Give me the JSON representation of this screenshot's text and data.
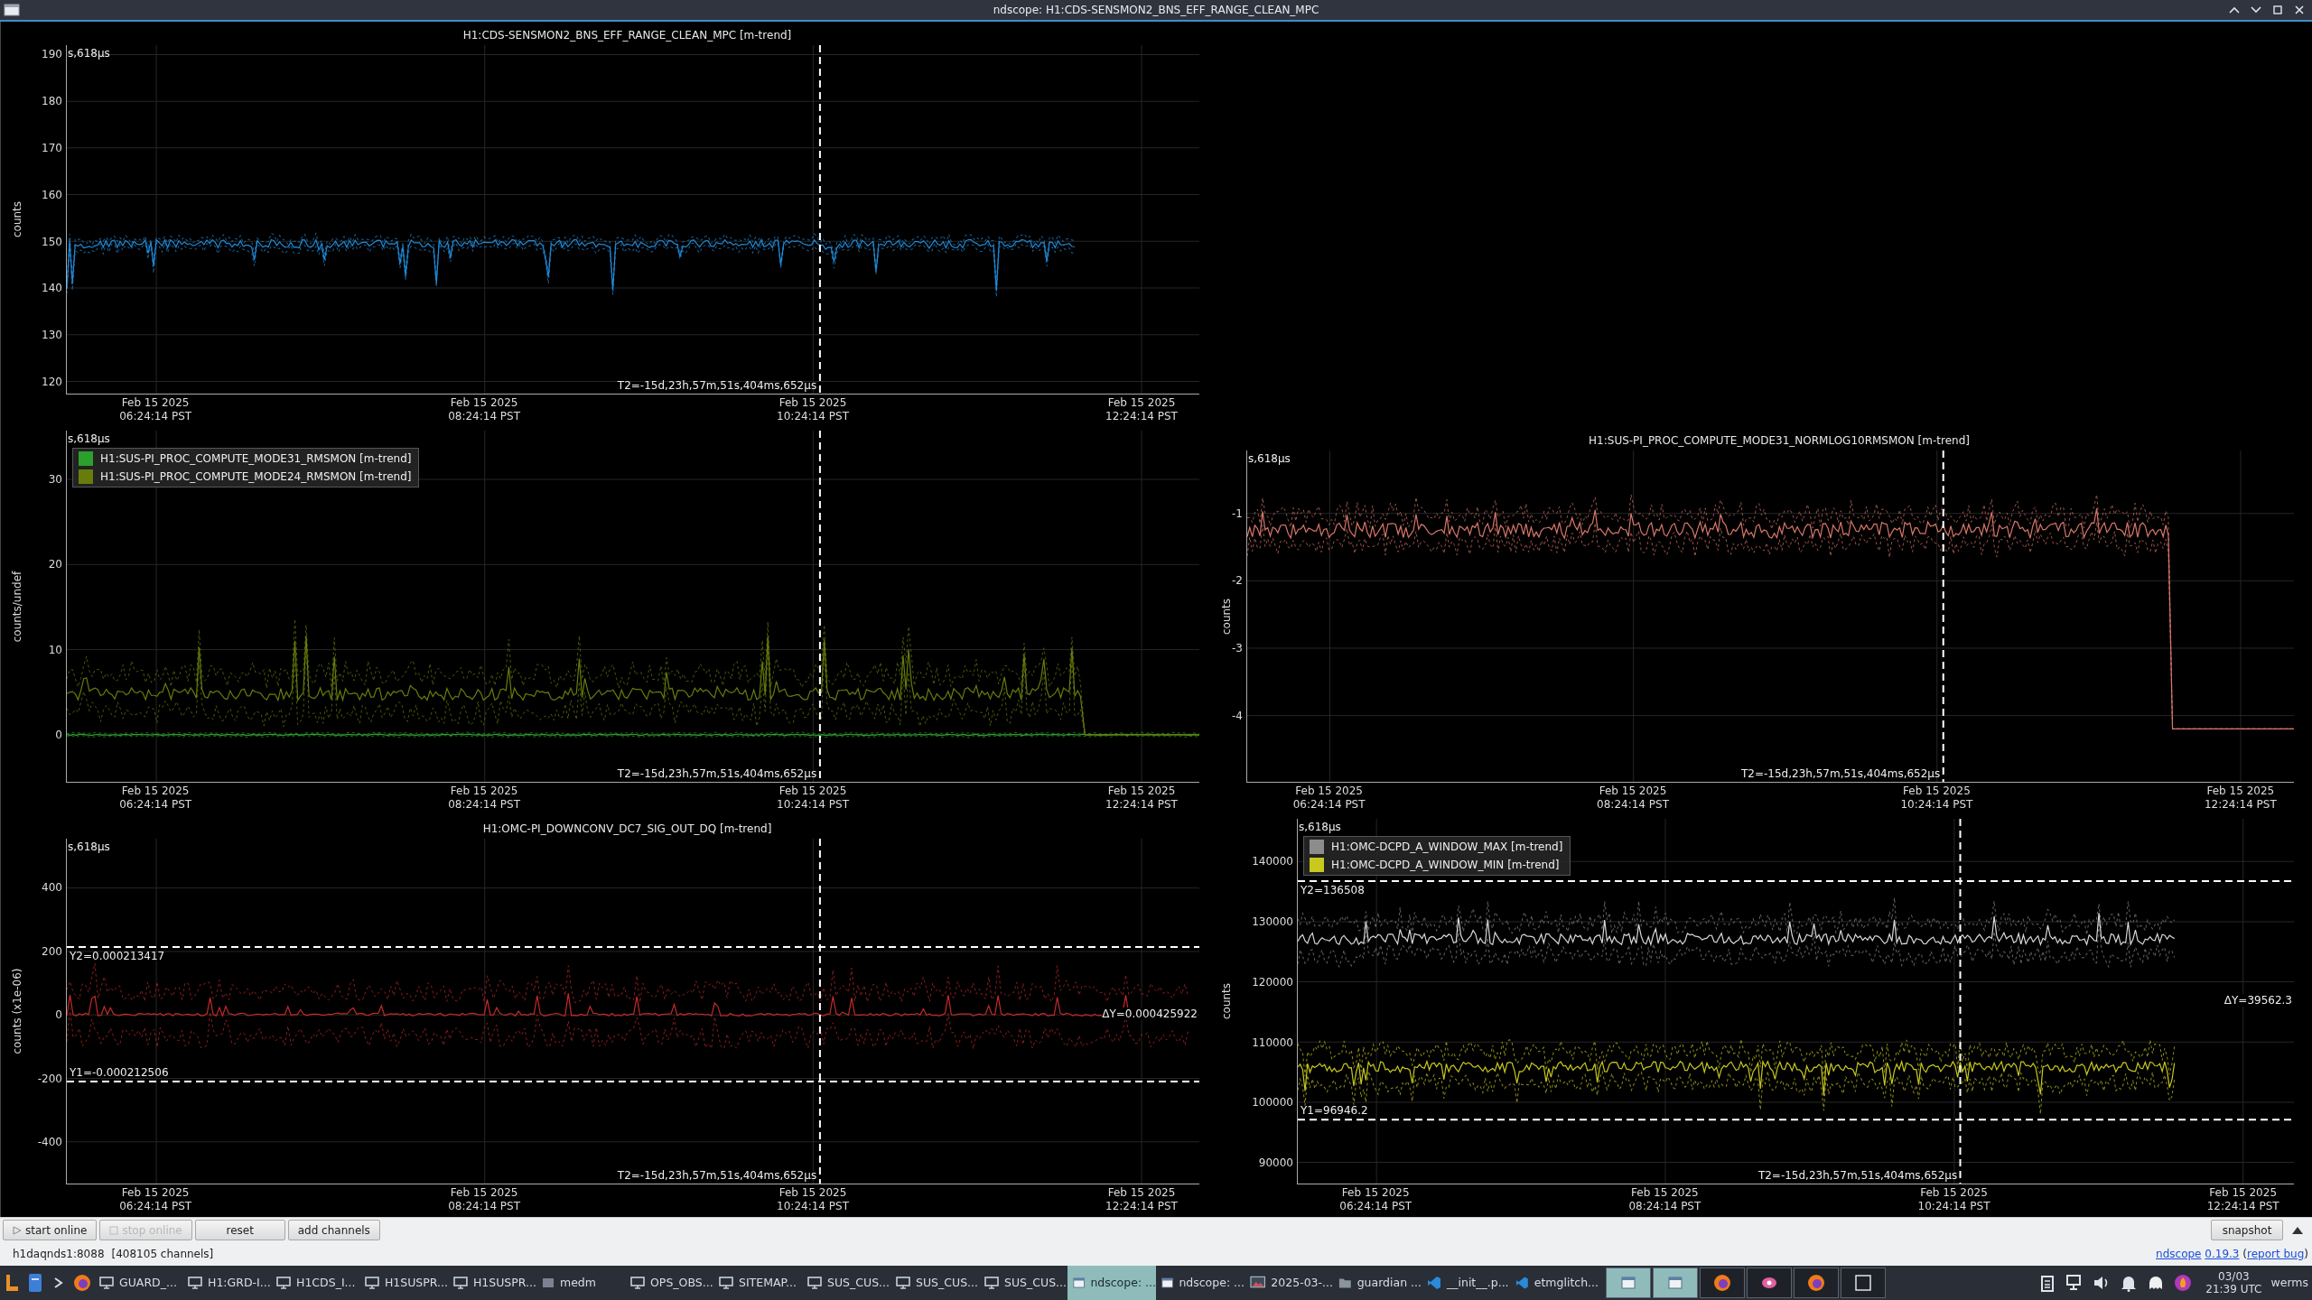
{
  "window": {
    "title": "ndscope: H1:CDS-SENSMON2_BNS_EFF_RANGE_CLEAN_MPC"
  },
  "plots": [
    {
      "title": "H1:CDS-SENSMON2_BNS_EFF_RANGE_CLEAN_MPC [m-trend]",
      "ylabel": "counts",
      "yticks": [
        "190",
        "180",
        "170",
        "160",
        "150",
        "140",
        "130",
        "120"
      ],
      "corner": "s,618µs",
      "cursor": "T2=-15d,23h,57m,51s,404ms,652µs",
      "traces": [
        {
          "color": "#1f8ad8"
        }
      ],
      "xticks": [
        {
          "date": "Feb 15 2025",
          "time": "06:24:14 PST"
        },
        {
          "date": "Feb 15 2025",
          "time": "08:24:14 PST"
        },
        {
          "date": "Feb 15 2025",
          "time": "10:24:14 PST"
        },
        {
          "date": "Feb 15 2025",
          "time": "12:24:14 PST"
        }
      ]
    },
    {
      "ylabel": "counts/undef",
      "yticks": [
        "30",
        "20",
        "10",
        "0"
      ],
      "corner": "s,618µs",
      "cursor": "T2=-15d,23h,57m,51s,404ms,652µs",
      "traces": [
        {
          "name": "H1:SUS-PI_PROC_COMPUTE_MODE31_RMSMON [m-trend]",
          "color": "#2ca02c"
        },
        {
          "name": "H1:SUS-PI_PROC_COMPUTE_MODE24_RMSMON [m-trend]",
          "color": "#667d0c"
        }
      ],
      "xticks": [
        {
          "date": "Feb 15 2025",
          "time": "06:24:14 PST"
        },
        {
          "date": "Feb 15 2025",
          "time": "08:24:14 PST"
        },
        {
          "date": "Feb 15 2025",
          "time": "10:24:14 PST"
        },
        {
          "date": "Feb 15 2025",
          "time": "12:24:14 PST"
        }
      ]
    },
    {
      "title": "H1:SUS-PI_PROC_COMPUTE_MODE31_NORMLOG10RMSMON [m-trend]",
      "ylabel": "counts",
      "yticks": [
        "-1",
        "-2",
        "-3",
        "-4"
      ],
      "corner": "s,618µs",
      "cursor": "T2=-15d,23h,57m,51s,404ms,652µs",
      "traces": [
        {
          "color": "#d8786a"
        }
      ],
      "xticks": [
        {
          "date": "Feb 15 2025",
          "time": "06:24:14 PST"
        },
        {
          "date": "Feb 15 2025",
          "time": "08:24:14 PST"
        },
        {
          "date": "Feb 15 2025",
          "time": "10:24:14 PST"
        },
        {
          "date": "Feb 15 2025",
          "time": "12:24:14 PST"
        }
      ]
    },
    {
      "title": "H1:OMC-PI_DOWNCONV_DC7_SIG_OUT_DQ [m-trend]",
      "ylabel": "counts (x1e-06)",
      "yticks": [
        "400",
        "200",
        "0",
        "-200",
        "-400"
      ],
      "corner": "s,618µs",
      "cursor": "T2=-15d,23h,57m,51s,404ms,652µs",
      "traces": [
        {
          "color": "#c42a2a"
        }
      ],
      "y_cursors": [
        {
          "label": "Y2=0.000213417"
        },
        {
          "label": "Y1=-0.000212506"
        }
      ],
      "delta": "ΔY=0.000425922",
      "xticks": [
        {
          "date": "Feb 15 2025",
          "time": "06:24:14 PST"
        },
        {
          "date": "Feb 15 2025",
          "time": "08:24:14 PST"
        },
        {
          "date": "Feb 15 2025",
          "time": "10:24:14 PST"
        },
        {
          "date": "Feb 15 2025",
          "time": "12:24:14 PST"
        }
      ]
    },
    {
      "ylabel": "counts",
      "yticks": [
        "140000",
        "130000",
        "120000",
        "110000",
        "100000",
        "90000"
      ],
      "corner": "s,618µs",
      "cursor": "T2=-15d,23h,57m,51s,404ms,652µs",
      "traces": [
        {
          "name": "H1:OMC-DCPD_A_WINDOW_MAX [m-trend]",
          "color": "#8c8c8c"
        },
        {
          "name": "H1:OMC-DCPD_A_WINDOW_MIN [m-trend]",
          "color": "#c8c81e"
        }
      ],
      "y_cursors": [
        {
          "label": "Y2=136508"
        },
        {
          "label": "Y1=96946.2"
        }
      ],
      "delta": "ΔY=39562.3",
      "xticks": [
        {
          "date": "Feb 15 2025",
          "time": "06:24:14 PST"
        },
        {
          "date": "Feb 15 2025",
          "time": "08:24:14 PST"
        },
        {
          "date": "Feb 15 2025",
          "time": "10:24:14 PST"
        },
        {
          "date": "Feb 15 2025",
          "time": "12:24:14 PST"
        }
      ]
    }
  ],
  "toolbar": {
    "buttons": [
      {
        "label": "start online",
        "kind": "play",
        "disabled": false
      },
      {
        "label": "stop online",
        "kind": "stop",
        "disabled": true
      },
      {
        "label": "reset",
        "kind": "plain",
        "disabled": false
      },
      {
        "label": "add channels",
        "kind": "plain",
        "disabled": false
      }
    ],
    "snapshot": "snapshot"
  },
  "status": {
    "server": "h1daqnds1:8088",
    "channels": "[408105 channels]",
    "app": "ndscope",
    "version": "0.19.3",
    "open": "(",
    "report": "report bug",
    "close": ")"
  },
  "taskbar": {
    "launchers": [
      {
        "kind": "launcher"
      },
      {
        "kind": "files"
      },
      {
        "kind": "terminal"
      },
      {
        "kind": "browser"
      }
    ],
    "tasks": [
      {
        "label": "GUARD_...",
        "kind": "monitor",
        "selected": false
      },
      {
        "label": "H1:GRD-I...",
        "kind": "monitor",
        "selected": false
      },
      {
        "label": "H1CDS_I...",
        "kind": "monitor",
        "selected": false
      },
      {
        "label": "H1SUSPR...",
        "kind": "monitor",
        "selected": false
      },
      {
        "label": "H1SUSPR...",
        "kind": "monitor",
        "selected": false
      },
      {
        "label": "medm",
        "kind": "square",
        "selected": false
      },
      {
        "label": "OPS_OBS...",
        "kind": "monitor",
        "selected": false
      },
      {
        "label": "SITEMAP...",
        "kind": "monitor",
        "selected": false
      },
      {
        "label": "SUS_CUS...",
        "kind": "monitor",
        "selected": false
      },
      {
        "label": "SUS_CUS...",
        "kind": "monitor",
        "selected": false
      },
      {
        "label": "SUS_CUS...",
        "kind": "monitor",
        "selected": false
      },
      {
        "label": "ndscope: ...",
        "kind": "window",
        "selected": true
      },
      {
        "label": "ndscope: ...",
        "kind": "window",
        "selected": false
      },
      {
        "label": "2025-03-...",
        "kind": "image",
        "selected": false
      },
      {
        "label": "guardian ...",
        "kind": "folder",
        "selected": false
      },
      {
        "label": "__init__.p...",
        "kind": "code",
        "selected": false
      },
      {
        "label": "etmglitch...",
        "kind": "code",
        "selected": false
      }
    ],
    "pinned": [
      {
        "kind": "window",
        "selected": true
      },
      {
        "kind": "window",
        "selected": true
      },
      {
        "kind": "browser",
        "selected": false
      },
      {
        "kind": "record",
        "selected": false
      },
      {
        "kind": "browser",
        "selected": false
      },
      {
        "kind": "blank",
        "selected": false
      }
    ],
    "tray": [
      {
        "kind": "clipboard"
      },
      {
        "kind": "network"
      },
      {
        "kind": "volume"
      },
      {
        "kind": "bell"
      },
      {
        "kind": "ghost"
      },
      {
        "kind": "flame"
      }
    ],
    "date": "03/03",
    "time": "21:39 UTC",
    "user": "werms"
  }
}
